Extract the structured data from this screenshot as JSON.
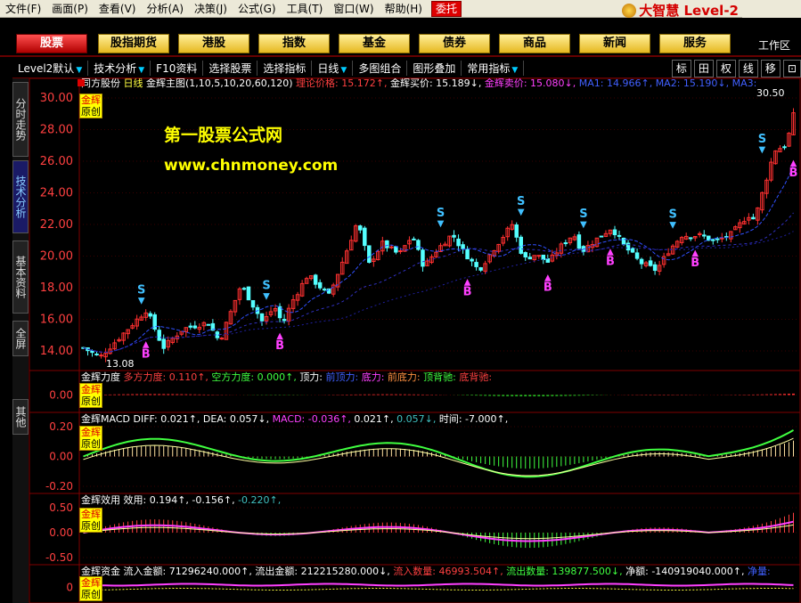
{
  "menubar": {
    "items": [
      "文件(F)",
      "画面(P)",
      "查看(V)",
      "分析(A)",
      "决策(J)",
      "公式(G)",
      "工具(T)",
      "窗口(W)",
      "帮助(H)"
    ],
    "weituo": "委托",
    "brand": "大智慧 Level-2"
  },
  "nav": {
    "buttons": [
      "股票",
      "股指期货",
      "港股",
      "指数",
      "基金",
      "债券",
      "商品",
      "新闻",
      "服务"
    ],
    "active": "股票",
    "workarea": "工作区"
  },
  "toolbar": {
    "items": [
      "Level2默认",
      "技术分析",
      "F10资料",
      "选择股票",
      "选择指标",
      "日线",
      "多图组合",
      "图形叠加",
      "常用指标"
    ],
    "right": [
      "标",
      "田",
      "权",
      "线",
      "移",
      "⊡"
    ]
  },
  "sidetabs": [
    "分时走势",
    "技术分析",
    "基本资料",
    "全屏",
    "其他"
  ],
  "main": {
    "stock": "同方股份",
    "period": "日线",
    "indicator": "金辉主图(1,10,5,10,20,60,120)",
    "labels": [
      {
        "t": "理论价格: 15.172↑,",
        "c": "#ff4040"
      },
      {
        "t": "金辉买价: 15.189↓,",
        "c": "#ffffff"
      },
      {
        "t": "金辉卖价: 15.080↓,",
        "c": "#ff40ff"
      },
      {
        "t": "MA1: 14.966↑,",
        "c": "#4060ff"
      },
      {
        "t": "MA2: 15.190↓,",
        "c": "#4060ff"
      },
      {
        "t": "MA3:",
        "c": "#4060ff"
      }
    ],
    "yticks": [
      "30.00",
      "28.00",
      "26.00",
      "24.00",
      "22.00",
      "20.00",
      "18.00",
      "16.00",
      "14.00"
    ],
    "high_label": "30.50",
    "low_label": "13.08",
    "watermark1": "第一股票公式网",
    "watermark2": "www.chnmoney.com"
  },
  "sub1": {
    "title": "金辉力度",
    "labels": [
      {
        "t": "多方力度: 0.110↑,",
        "c": "#ff4040"
      },
      {
        "t": "空方力度: 0.000↑,",
        "c": "#40ff40"
      },
      {
        "t": "顶力: ",
        "c": "#ffffff"
      },
      {
        "t": "前顶力:",
        "c": "#4060ff"
      },
      {
        "t": "底力:",
        "c": "#ff40ff"
      },
      {
        "t": "前底力:",
        "c": "#ff9040"
      },
      {
        "t": "顶背驰:",
        "c": "#40ff40"
      },
      {
        "t": "底背驰:",
        "c": "#ff4040"
      }
    ],
    "yticks": [
      "0.00"
    ]
  },
  "sub2": {
    "title": "金辉MACD",
    "labels": [
      {
        "t": "DIFF: 0.021↑,",
        "c": "#ffffff"
      },
      {
        "t": "DEA: 0.057↓,",
        "c": "#ffffff"
      },
      {
        "t": "MACD: -0.036↑,",
        "c": "#ff40ff"
      },
      {
        "t": "0.021↑,",
        "c": "#ffffff"
      },
      {
        "t": "0.057↓,",
        "c": "#40c0c0"
      },
      {
        "t": "时间: -7.000↑,",
        "c": "#ffffff"
      }
    ],
    "yticks": [
      "0.20",
      "0.00",
      "-0.20"
    ]
  },
  "sub3": {
    "title": "金辉效用",
    "labels": [
      {
        "t": "效用: 0.194↑,",
        "c": "#ffffff"
      },
      {
        "t": "-0.156↑,",
        "c": "#ffffff"
      },
      {
        "t": "-0.220↑,",
        "c": "#40c0c0"
      }
    ],
    "yticks": [
      "0.50",
      "0.00",
      "-0.50"
    ]
  },
  "sub4": {
    "title": "金辉资金",
    "labels": [
      {
        "t": "流入金额: 71296240.000↑,",
        "c": "#ffffff"
      },
      {
        "t": "流出金额: 212215280.000↓,",
        "c": "#ffffff"
      },
      {
        "t": "流入数量: 46993.504↑,",
        "c": "#ff4040"
      },
      {
        "t": "流出数量: 139877.500↓,",
        "c": "#40ff40"
      },
      {
        "t": "净额: -140919040.000↑,",
        "c": "#ffffff"
      },
      {
        "t": "净量:",
        "c": "#4060ff"
      }
    ],
    "yticks": [
      "0"
    ]
  },
  "badge": {
    "line1": "金辉",
    "line2": "原创"
  },
  "signals": {
    "buy": "B",
    "sell": "S"
  },
  "colors": {
    "up": "#ff3030",
    "down": "#54ffff",
    "grid": "#800000"
  }
}
